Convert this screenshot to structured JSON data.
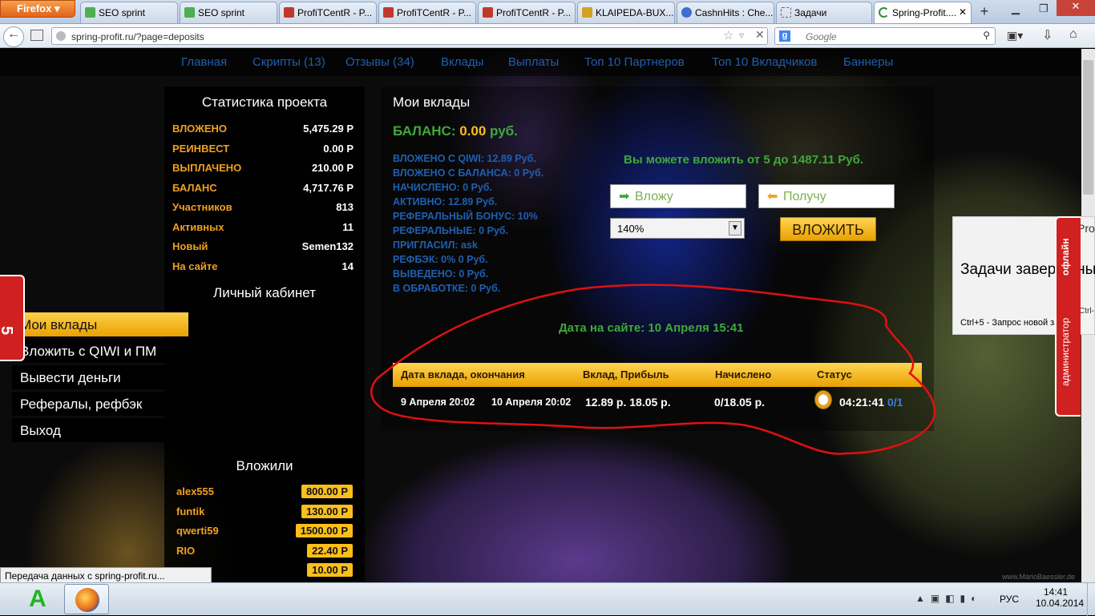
{
  "browser": {
    "firefox_label": "Firefox",
    "tabs": [
      {
        "label": "SEO sprint",
        "icon": "seosprint-icon"
      },
      {
        "label": "SEO sprint",
        "icon": "seosprint-icon"
      },
      {
        "label": "ProfiTCentR - P...",
        "icon": "chart-icon"
      },
      {
        "label": "ProfiTCentR - P...",
        "icon": "chart-icon"
      },
      {
        "label": "ProfiTCentR - P...",
        "icon": "chart-icon"
      },
      {
        "label": "KLAIPEDA-BUX....",
        "icon": "pen-icon"
      },
      {
        "label": "CashnHits : Che...",
        "icon": "globe-icon"
      },
      {
        "label": "Задачи",
        "icon": "page-icon"
      },
      {
        "label": "Spring-Profit....",
        "icon": "loading-icon"
      }
    ],
    "new_tab": "+",
    "url": "spring-profit.ru/?page=deposits",
    "search_placeholder": "Google"
  },
  "site": {
    "menu": [
      "Главная",
      "Скрипты (13)",
      "Отзывы (34)",
      "Вклады",
      "Выплаты",
      "Топ 10 Партнеров",
      "Топ 10 Вкладчиков",
      "Баннеры"
    ],
    "stats_title": "Статистика проекта",
    "stats": [
      {
        "k": "ВЛОЖЕНО",
        "v": "5,475.29 Р"
      },
      {
        "k": "РЕИНВЕСТ",
        "v": "0.00 Р"
      },
      {
        "k": "ВЫПЛАЧЕНО",
        "v": "210.00 Р"
      },
      {
        "k": "БАЛАНС",
        "v": "4,717.76 Р"
      },
      {
        "k": "Участников",
        "v": "813"
      },
      {
        "k": "Активных",
        "v": "11"
      },
      {
        "k": "Новый",
        "v": "Semen132"
      },
      {
        "k": "На сайте",
        "v": "14"
      }
    ],
    "cabinet_title": "Личный кабинет",
    "cabinet": [
      "Мои вклады",
      "Вложить с QIWI и ПМ",
      "Вывести деньги",
      "Рефералы, рефбэк",
      "Выход"
    ],
    "invested_title": "Вложили",
    "invested": [
      {
        "name": "alex555",
        "amount": "800.00 Р"
      },
      {
        "name": "funtik",
        "amount": "130.00 Р"
      },
      {
        "name": "qwerti59",
        "amount": "1500.00 Р"
      },
      {
        "name": "RIO",
        "amount": "22.40 Р"
      },
      {
        "name": "",
        "amount": "10.00 Р"
      }
    ],
    "main_title": "Мои вклады",
    "balance_label": "БАЛАНС:",
    "balance_value": "0.00",
    "balance_unit": "руб.",
    "info_lines": [
      "ВЛОЖЕНО С QIWI: 12.89 Руб.",
      "ВЛОЖЕНО С БАЛАНСА: 0 Руб.",
      "НАЧИСЛЕНО: 0 Руб.",
      "АКТИВНО: 12.89 Руб.",
      "РЕФЕРАЛЬНЫЙ БОНУС: 10%",
      "РЕФЕРАЛЬНЫЕ: 0 Руб.",
      "ПРИГЛАСИЛ: ask",
      "РЕФБЭК: 0% 0 Руб.",
      "ВЫВЕДЕНО: 0 Руб.",
      "В ОБРАБОТКЕ: 0 Руб."
    ],
    "invest_range": "Вы можете вложить от 5 до 1487.11 Руб.",
    "invest_placeholder": "Вложу",
    "receive_placeholder": "Получу",
    "plan_selected": "140%",
    "invest_button": "ВЛОЖИТЬ",
    "date_on_site": "Дата на сайте: 10 Апреля 15:41",
    "table_headers": [
      "Дата вклада, окончания",
      "Вклад, Прибыль",
      "Начислено",
      "Статус"
    ],
    "deposits": [
      {
        "start": "9 Апреля 20:02",
        "end": "10 Апреля 20:02",
        "amount": "12.89 р. 18.05 р.",
        "accrued": "0/18.05 р.",
        "timer": "04:21:41",
        "count": "0/1"
      }
    ],
    "watermark": "www.MarioBaessler.de"
  },
  "side_widget": {
    "badge": "5",
    "right_tab_top": "офлайн",
    "right_tab_bottom": "администратор",
    "popup_header": "Pro",
    "popup_title": "Задачи завершены",
    "popup_hint": "Ctrl+5 - Запрос новой задачи",
    "popup_ctrl": "Ctrl-"
  },
  "status_bar": "Передача данных с spring-profit.ru...",
  "taskbar": {
    "lang": "РУС",
    "time": "14:41",
    "date": "10.04.2014"
  },
  "colors": {
    "accent": "#fbbf1a",
    "link": "#1f5fb0",
    "green": "#3fa83a",
    "annotation": "#e01010"
  }
}
